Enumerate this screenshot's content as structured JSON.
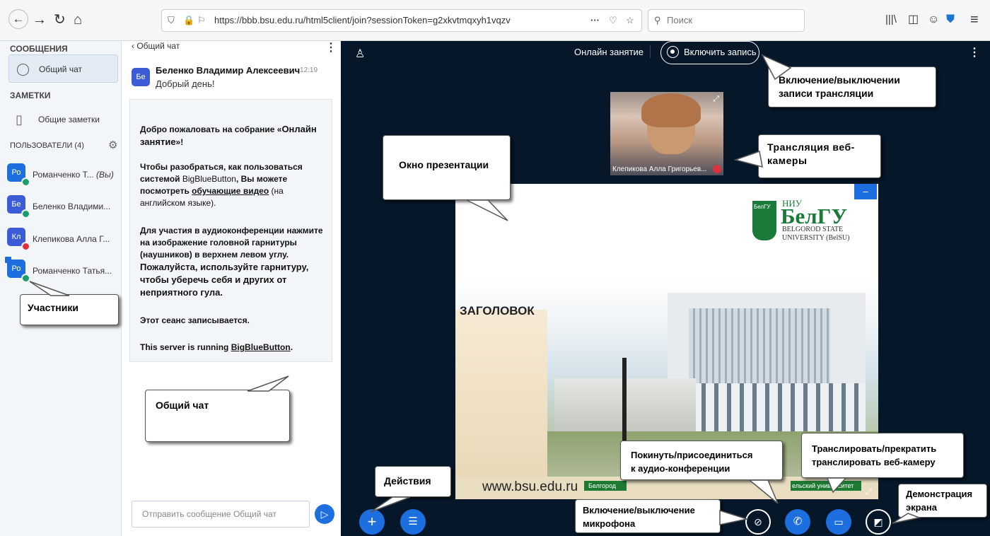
{
  "browser": {
    "url": "https://bbb.bsu.edu.ru/html5client/join?sessionToken=g2xkvtmqxyh1vqzv",
    "search_placeholder": "Поиск",
    "more": "···"
  },
  "sidebar": {
    "messages_header": "СООБЩЕНИЯ",
    "public_chat": "Общий чат",
    "notes_header": "ЗАМЕТКИ",
    "shared_notes": "Общие заметки",
    "users_header": "ПОЛЬЗОВАТЕЛИ (4)",
    "users": [
      {
        "initials": "Ро",
        "name": "Романченко Т...",
        "suffix": "(Вы)",
        "color": "#1d6fe0",
        "status": "#1a9e6b"
      },
      {
        "initials": "Бе",
        "name": "Беленко Владими...",
        "suffix": "",
        "color": "#3b5cd6",
        "status": "#1a9e6b"
      },
      {
        "initials": "Кл",
        "name": "Клепикова Алла Г...",
        "suffix": "",
        "color": "#3b5cd6",
        "status": "#d9343e"
      },
      {
        "initials": "Ро",
        "name": "Романченко Татья...",
        "suffix": "",
        "color": "#1d6fe0",
        "status": "#1a9e6b"
      }
    ]
  },
  "chat": {
    "back_title": "Общий чат",
    "sender_initials": "Бе",
    "sender_name": "Беленко Владимир Алексеевич",
    "time": "12:19",
    "message": "Добрый день!",
    "welcome_1a": "Добро пожаловать на собрание «",
    "welcome_1b": "Онлайн занятие",
    "welcome_1c": "»!",
    "welcome_2a": "Чтобы разобраться, как пользоваться системой ",
    "welcome_2b": "BigBlueButton",
    "welcome_2c": ", Вы можете посмотреть ",
    "welcome_2d": "обучающие видео",
    "welcome_2e": " (на английском языке).",
    "welcome_3a": "Для участия в аудиоконференции нажмите на изображение головной гарнитуры (наушников) в верхнем левом углу. ",
    "welcome_3b": "Пожалуйста, используйте гарнитуру, чтобы уберечь себя и других от неприятного гула.",
    "welcome_4": "Этот сеанс записывается.",
    "welcome_5a": "This server is running ",
    "welcome_5b": "BigBlueButton",
    "welcome_5c": ".",
    "input_placeholder": "Отправить сообщение Общий чат"
  },
  "main": {
    "meeting_title": "Онлайн занятие",
    "record_button": "Включить запись",
    "webcam_name": "Клепикова Алла Григорьев...",
    "minimize": "–",
    "slide": {
      "logo_niu": "НИУ",
      "logo_belgu": "БелГУ",
      "logo_line1": "BELGOROD STATE",
      "logo_line2": "UNIVERSITY (BelSU)",
      "seal_text": "БелГУ",
      "heading": "ЗАГОЛОВОК",
      "footer_url": "www.bsu.edu.ru",
      "footer_left": "Белгород",
      "footer_right": "ельский университет"
    }
  },
  "callouts": {
    "recording_1": "Включение/выключении",
    "recording_2": "записи трансляции",
    "webcam_1": "Трансляция  веб-",
    "webcam_2": "камеры",
    "presentation": "Окно презентации",
    "participants": "Участники",
    "chat": "Общий чат",
    "actions": "Действия",
    "audio_1": "Покинуть/присоединиться",
    "audio_2": "к аудио-конференции",
    "cam_1": "Транслировать/прекратить",
    "cam_2": "транслировать веб-камеру",
    "mic_1": "Включение/выключение",
    "mic_2": "микрофона",
    "screen_1": "Демонстрация",
    "screen_2": "экрана"
  }
}
